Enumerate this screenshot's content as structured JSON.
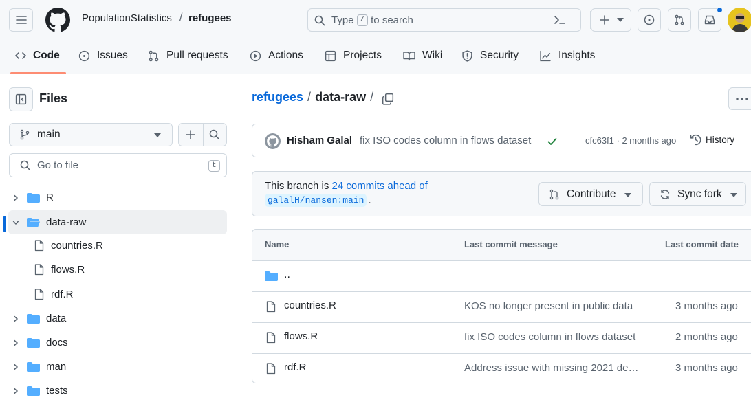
{
  "header": {
    "owner": "PopulationStatistics",
    "separator": "/",
    "repo": "refugees",
    "search": {
      "prefix": "Type",
      "key": "/",
      "suffix": "to search"
    }
  },
  "repo_nav": {
    "tabs": [
      {
        "label": "Code",
        "icon": "code-icon"
      },
      {
        "label": "Issues",
        "icon": "issue-icon"
      },
      {
        "label": "Pull requests",
        "icon": "pull-request-icon"
      },
      {
        "label": "Actions",
        "icon": "play-icon"
      },
      {
        "label": "Projects",
        "icon": "table-icon"
      },
      {
        "label": "Wiki",
        "icon": "book-icon"
      },
      {
        "label": "Security",
        "icon": "shield-icon"
      },
      {
        "label": "Insights",
        "icon": "graph-icon"
      }
    ]
  },
  "sidebar": {
    "title": "Files",
    "branch": "main",
    "goto_placeholder": "Go to file",
    "goto_key": "t",
    "tree": [
      {
        "name": "R",
        "type": "folder"
      },
      {
        "name": "data-raw",
        "type": "folder-open",
        "selected": true
      },
      {
        "name": "countries.R",
        "type": "file"
      },
      {
        "name": "flows.R",
        "type": "file"
      },
      {
        "name": "rdf.R",
        "type": "file"
      },
      {
        "name": "data",
        "type": "folder"
      },
      {
        "name": "docs",
        "type": "folder"
      },
      {
        "name": "man",
        "type": "folder"
      },
      {
        "name": "tests",
        "type": "folder"
      }
    ]
  },
  "main": {
    "breadcrumb": {
      "repo": "refugees",
      "sep": "/",
      "folder": "data-raw",
      "trail": "/"
    },
    "commit": {
      "author": "Hisham Galal",
      "message": "fix ISO codes column in flows dataset",
      "meta": "cfc63f1 · 2 months ago",
      "history": "History"
    },
    "branch_info": {
      "text_before": "This branch is",
      "ahead_link": "24 commits ahead of",
      "upstream": "galalH/nansen:main",
      "period": ".",
      "contribute": "Contribute",
      "sync": "Sync fork"
    },
    "table": {
      "headers": {
        "name": "Name",
        "message": "Last commit message",
        "date": "Last commit date"
      },
      "parent": "..",
      "rows": [
        {
          "name": "countries.R",
          "message": "KOS no longer present in public data",
          "date": "3 months ago"
        },
        {
          "name": "flows.R",
          "message": "fix ISO codes column in flows dataset",
          "date": "2 months ago"
        },
        {
          "name": "rdf.R",
          "message": "Address issue with missing 2021 de…",
          "date": "3 months ago"
        }
      ]
    }
  },
  "colors": {
    "accent": "#0969da",
    "folder": "#54aeff",
    "success": "#1a7f37",
    "tab_underline": "#fd8c73"
  }
}
